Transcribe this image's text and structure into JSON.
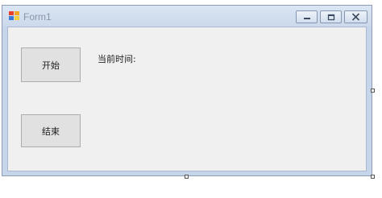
{
  "window": {
    "title": "Form1",
    "controls": {
      "minimize_icon": "minimize-icon",
      "maximize_icon": "maximize-icon",
      "close_icon": "close-icon"
    }
  },
  "form": {
    "start_label": "开始",
    "stop_label": "结束",
    "time_label": "当前时间:"
  },
  "colors": {
    "titlebar": "#cbd9ec",
    "client_background": "#f0f0f0",
    "button_background": "#e1e1e1"
  }
}
